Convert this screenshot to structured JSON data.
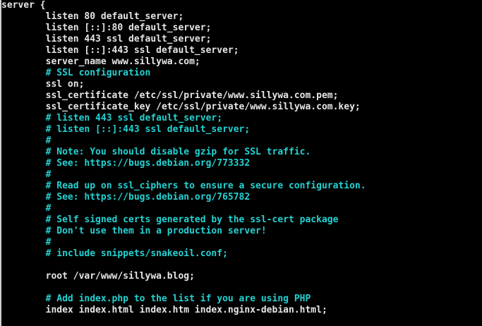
{
  "terminal": {
    "colors": {
      "background": "#000000",
      "code": "#e6e6e6",
      "comment": "#24d2d2"
    },
    "lines": [
      {
        "text": "server {",
        "kind": "code"
      },
      {
        "text": "        listen 80 default_server;",
        "kind": "code"
      },
      {
        "text": "        listen [::]:80 default_server;",
        "kind": "code"
      },
      {
        "text": "        listen 443 ssl default_server;",
        "kind": "code"
      },
      {
        "text": "        listen [::]:443 ssl default_server;",
        "kind": "code"
      },
      {
        "text": "        server_name www.sillywa.com;",
        "kind": "code"
      },
      {
        "text": "        # SSL configuration",
        "kind": "comment"
      },
      {
        "text": "        ssl on;",
        "kind": "code"
      },
      {
        "text": "        ssl_certificate /etc/ssl/private/www.sillywa.com.pem;",
        "kind": "code"
      },
      {
        "text": "        ssl_certificate_key /etc/ssl/private/www.sillywa.com.key;",
        "kind": "code"
      },
      {
        "text": "        # listen 443 ssl default_server;",
        "kind": "comment"
      },
      {
        "text": "        # listen [::]:443 ssl default_server;",
        "kind": "comment"
      },
      {
        "text": "        #",
        "kind": "comment"
      },
      {
        "text": "        # Note: You should disable gzip for SSL traffic.",
        "kind": "comment"
      },
      {
        "text": "        # See: https://bugs.debian.org/773332",
        "kind": "comment"
      },
      {
        "text": "        #",
        "kind": "comment"
      },
      {
        "text": "        # Read up on ssl_ciphers to ensure a secure configuration.",
        "kind": "comment"
      },
      {
        "text": "        # See: https://bugs.debian.org/765782",
        "kind": "comment"
      },
      {
        "text": "        #",
        "kind": "comment"
      },
      {
        "text": "        # Self signed certs generated by the ssl-cert package",
        "kind": "comment"
      },
      {
        "text": "        # Don't use them in a production server!",
        "kind": "comment"
      },
      {
        "text": "        #",
        "kind": "comment"
      },
      {
        "text": "        # include snippets/snakeoil.conf;",
        "kind": "comment"
      },
      {
        "text": "",
        "kind": "code"
      },
      {
        "text": "        root /var/www/sillywa.blog;",
        "kind": "code"
      },
      {
        "text": "",
        "kind": "code"
      },
      {
        "text": "        # Add index.php to the list if you are using PHP",
        "kind": "comment"
      },
      {
        "text": "        index index.html index.htm index.nginx-debian.html;",
        "kind": "code"
      }
    ]
  }
}
